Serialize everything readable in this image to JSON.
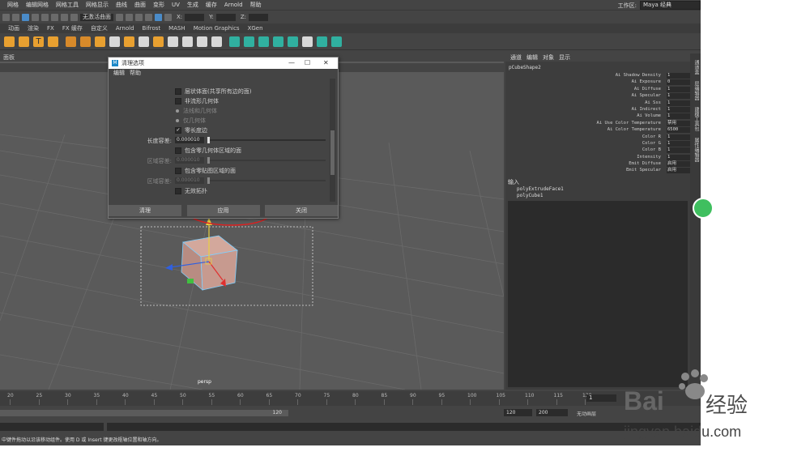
{
  "menubar": {
    "items": [
      "网格",
      "编辑网格",
      "网格工具",
      "网格显示",
      "曲线",
      "曲面",
      "变形",
      "UV",
      "生成",
      "缓存",
      "Arnold",
      "帮助"
    ],
    "workspace_label": "工作区:",
    "workspace_value": "Maya 经典"
  },
  "statusline": {
    "live_surface": "无激活曲面",
    "x_label": "X:",
    "y_label": "Y:",
    "z_label": "Z:"
  },
  "shelf": {
    "tabs": [
      "动画",
      "渲染",
      "FX",
      "FX 缓存",
      "自定义",
      "Arnold",
      "Bifrost",
      "MASH",
      "Motion Graphics",
      "XGen"
    ]
  },
  "viewport": {
    "panel_menu": "面板",
    "camera_label": "persp"
  },
  "attr_editor": {
    "tabs": [
      "通道",
      "编辑",
      "对象",
      "显示"
    ],
    "node_name": "pCubeShape2",
    "attributes": [
      {
        "name": "Ai Shadow Density",
        "value": "1"
      },
      {
        "name": "Ai Exposure",
        "value": "0"
      },
      {
        "name": "Ai Diffuse",
        "value": "1"
      },
      {
        "name": "Ai Specular",
        "value": "1"
      },
      {
        "name": "Ai Sss",
        "value": "1"
      },
      {
        "name": "Ai Indirect",
        "value": "1"
      },
      {
        "name": "Ai Volume",
        "value": "1"
      },
      {
        "name": "Ai Use Color Temperature",
        "value": "禁用"
      },
      {
        "name": "Ai Color Temperature",
        "value": "6500"
      },
      {
        "name": "Color R",
        "value": "1"
      },
      {
        "name": "Color G",
        "value": "1"
      },
      {
        "name": "Color B",
        "value": "1"
      },
      {
        "name": "Intensity",
        "value": "1"
      },
      {
        "name": "Emit Diffuse",
        "value": "启用"
      },
      {
        "name": "Emit Specular",
        "value": "启用"
      }
    ],
    "inputs_header": "输入",
    "inputs": [
      "polyExtrudeFace1",
      "polyCube1"
    ],
    "side_tabs": [
      "通道盒",
      "层编辑器",
      "建模工具包",
      "属性编辑器"
    ]
  },
  "dialog": {
    "title": "清理选项",
    "menu": [
      "编辑",
      "帮助"
    ],
    "options": [
      {
        "label": "层状体面(共享所有边的面)",
        "checked": false,
        "type": "checkbox",
        "enabled": true
      },
      {
        "label": "非流形几何体",
        "checked": false,
        "type": "checkbox",
        "enabled": true
      },
      {
        "label": "法线和几何体",
        "type": "radio",
        "enabled": false
      },
      {
        "label": "仅几何体",
        "type": "radio",
        "enabled": false
      },
      {
        "label": "零长度边",
        "checked": true,
        "type": "checkbox",
        "enabled": true
      }
    ],
    "length_tol_label": "长度容差:",
    "length_tol_value": "0.000010",
    "zero_area_faces_label": "包含零几何体区域的面",
    "area_tol_label": "区域容差:",
    "area_tol_value": "0.000010",
    "zero_map_faces_label": "包含零贴图区域的面",
    "map_area_tol_label": "区域容差:",
    "map_area_tol_value": "0.000010",
    "lamina_label": "无效拓扑",
    "buttons": [
      "清理",
      "应用",
      "关闭"
    ]
  },
  "timeline": {
    "ticks": [
      "20",
      "25",
      "30",
      "35",
      "40",
      "45",
      "50",
      "55",
      "60",
      "65",
      "70",
      "75",
      "80",
      "85",
      "90",
      "95",
      "100",
      "105",
      "110",
      "115",
      "120"
    ],
    "current_frame": "1"
  },
  "range": {
    "end_label": "120",
    "start_field": "120",
    "end_field": "200",
    "option": "无动画层"
  },
  "helpline": {
    "text": "中键件拖动以沿该移动组件。使用 D 或 Insert 键更改枢轴位置和轴方向。"
  },
  "watermark": {
    "brand": "Bai",
    "brand_cn": "经验",
    "site": "jingyan.baidu.com"
  },
  "colors": {
    "annotation_red": "#e02020",
    "cube_fill": "#c79a8f",
    "accent_blue": "#4a8bc8"
  }
}
